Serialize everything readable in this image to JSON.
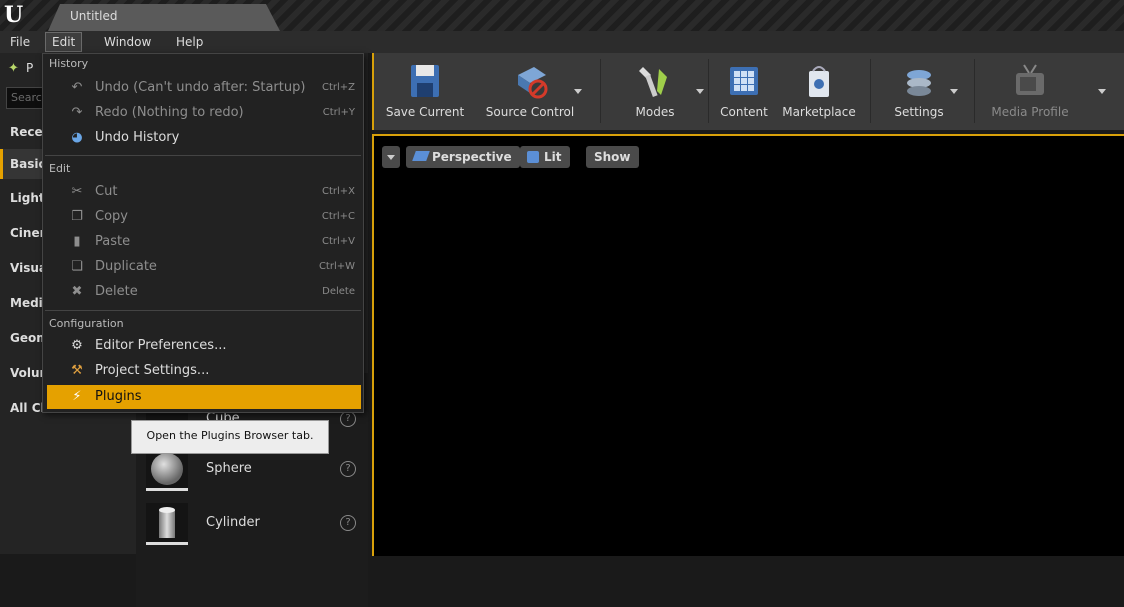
{
  "window": {
    "tab_title": "Untitled"
  },
  "menubar": [
    {
      "label": "File"
    },
    {
      "label": "Edit"
    },
    {
      "label": "Window"
    },
    {
      "label": "Help"
    }
  ],
  "modes": {
    "header_label": "P",
    "search_placeholder": "Searc"
  },
  "categories": [
    {
      "label": "Recer"
    },
    {
      "label": "Basic"
    },
    {
      "label": "Lights"
    },
    {
      "label": "Cinen"
    },
    {
      "label": "Visua"
    },
    {
      "label": "Media"
    },
    {
      "label": "Geom"
    },
    {
      "label": "Volun"
    },
    {
      "label": "All Cla"
    }
  ],
  "placeables": [
    {
      "label": "Cube"
    },
    {
      "label": "Sphere"
    },
    {
      "label": "Cylinder"
    }
  ],
  "toolbar": [
    {
      "label": "Save Current",
      "icon": "save-icon"
    },
    {
      "label": "Source Control",
      "icon": "source-control-icon"
    },
    {
      "label": "Modes",
      "icon": "modes-icon"
    },
    {
      "label": "Content",
      "icon": "content-icon"
    },
    {
      "label": "Marketplace",
      "icon": "marketplace-icon"
    },
    {
      "label": "Settings",
      "icon": "settings-icon"
    },
    {
      "label": "Media Profile",
      "icon": "media-profile-icon"
    }
  ],
  "viewport": {
    "perspective": "Perspective",
    "lit": "Lit",
    "show": "Show"
  },
  "edit_menu": {
    "history_header": "History",
    "undo": "Undo (Can't undo after: Startup)",
    "undo_sc": "Ctrl+Z",
    "redo": "Redo (Nothing to redo)",
    "redo_sc": "Ctrl+Y",
    "undo_history": "Undo History",
    "edit_header": "Edit",
    "cut": "Cut",
    "cut_sc": "Ctrl+X",
    "copy": "Copy",
    "copy_sc": "Ctrl+C",
    "paste": "Paste",
    "paste_sc": "Ctrl+V",
    "duplicate": "Duplicate",
    "duplicate_sc": "Ctrl+W",
    "delete": "Delete",
    "delete_sc": "Delete",
    "config_header": "Configuration",
    "editor_prefs": "Editor Preferences...",
    "project_settings": "Project Settings...",
    "plugins": "Plugins"
  },
  "tooltip": "Open the Plugins Browser tab.",
  "colors": {
    "accent": "#e5a100",
    "viewport_border": "#d9a10a"
  }
}
